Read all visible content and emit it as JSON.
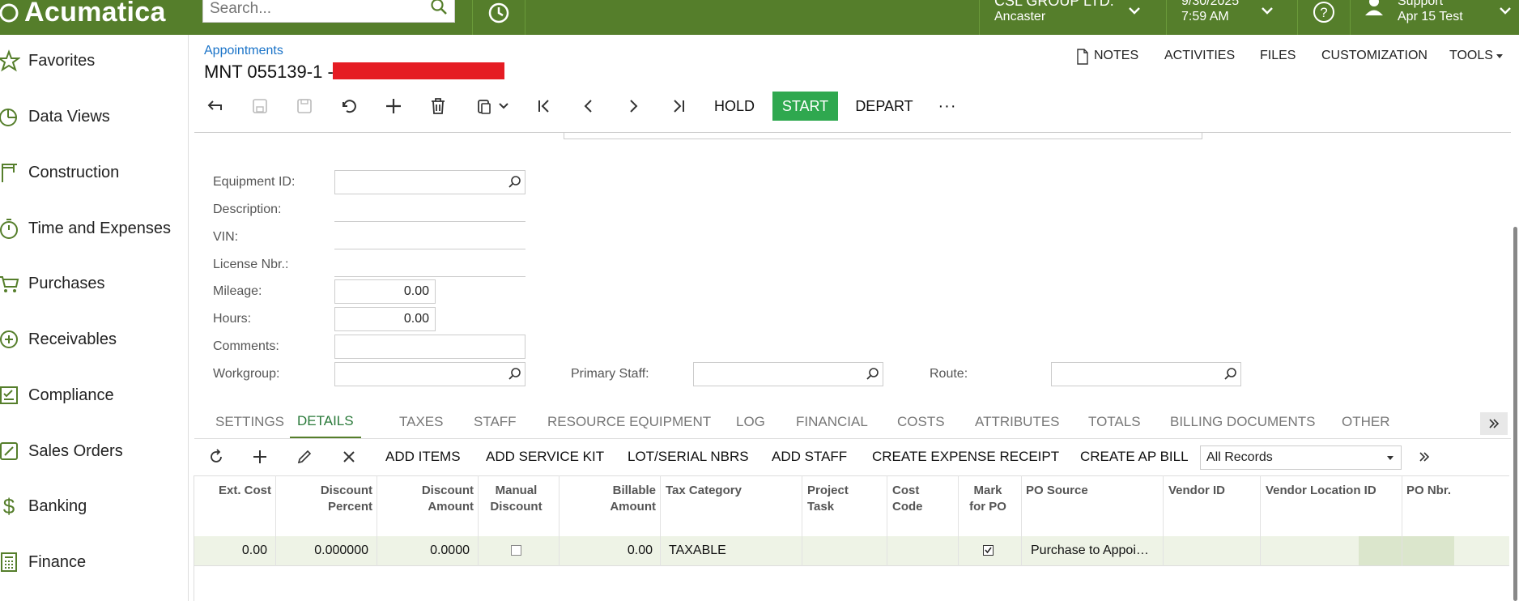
{
  "header": {
    "brand": "Acumatica",
    "search_placeholder": "Search...",
    "tenant_name": "CSL GROUP LTD.",
    "tenant_branch": "Ancaster",
    "date": "9/30/2025",
    "time": "7:59 AM",
    "user_name": "Support",
    "user_sub": "Apr 15 Test",
    "brand_color": "#557e2b"
  },
  "sidebar": {
    "items": [
      {
        "label": "Favorites",
        "icon": "star-icon"
      },
      {
        "label": "Data Views",
        "icon": "pie-chart-icon"
      },
      {
        "label": "Construction",
        "icon": "crane-icon"
      },
      {
        "label": "Time and Expenses",
        "icon": "stopwatch-icon"
      },
      {
        "label": "Purchases",
        "icon": "cart-icon"
      },
      {
        "label": "Receivables",
        "icon": "plus-circle-icon"
      },
      {
        "label": "Compliance",
        "icon": "checklist-icon"
      },
      {
        "label": "Sales Orders",
        "icon": "pencil-icon"
      },
      {
        "label": "Banking",
        "icon": "dollar-icon"
      },
      {
        "label": "Finance",
        "icon": "calculator-icon"
      }
    ]
  },
  "page": {
    "breadcrumb": "Appointments",
    "title": "MNT 055139-1 -",
    "top_links": [
      "NOTES",
      "ACTIVITIES",
      "FILES",
      "CUSTOMIZATION",
      "TOOLS"
    ],
    "actions": {
      "hold": "HOLD",
      "start": "START",
      "depart": "DEPART",
      "more": "···"
    }
  },
  "form": {
    "equipment_id_label": "Equipment ID:",
    "equipment_id_value": "",
    "description_label": "Description:",
    "vin_label": "VIN:",
    "license_label": "License Nbr.:",
    "mileage_label": "Mileage:",
    "mileage_value": "0.00",
    "hours_label": "Hours:",
    "hours_value": "0.00",
    "comments_label": "Comments:",
    "workgroup_label": "Workgroup:",
    "primary_staff_label": "Primary Staff:",
    "route_label": "Route:"
  },
  "tabs": [
    "SETTINGS",
    "DETAILS",
    "TAXES",
    "STAFF",
    "RESOURCE EQUIPMENT",
    "LOG",
    "FINANCIAL",
    "COSTS",
    "ATTRIBUTES",
    "TOTALS",
    "BILLING DOCUMENTS",
    "OTHER"
  ],
  "grid_toolbar": {
    "add_items": "ADD ITEMS",
    "add_service_kit": "ADD SERVICE KIT",
    "lot_serial": "LOT/SERIAL NBRS",
    "add_staff": "ADD STAFF",
    "create_expense": "CREATE EXPENSE RECEIPT",
    "create_ap_bill": "CREATE AP BILL",
    "filter": "All Records"
  },
  "grid": {
    "columns": [
      {
        "l1": "Ext. Cost",
        "l2": ""
      },
      {
        "l1": "Discount",
        "l2": "Percent"
      },
      {
        "l1": "Discount",
        "l2": "Amount"
      },
      {
        "l1": "Manual",
        "l2": "Discount"
      },
      {
        "l1": "Billable",
        "l2": "Amount"
      },
      {
        "l1": "Tax Category",
        "l2": ""
      },
      {
        "l1": "Project",
        "l2": "Task"
      },
      {
        "l1": "Cost",
        "l2": "Code"
      },
      {
        "l1": "Mark",
        "l2": "for PO"
      },
      {
        "l1": "PO Source",
        "l2": ""
      },
      {
        "l1": "Vendor ID",
        "l2": ""
      },
      {
        "l1": "Vendor Location ID",
        "l2": ""
      },
      {
        "l1": "PO Nbr.",
        "l2": ""
      }
    ],
    "row": {
      "ext_cost": "0.00",
      "discount_percent": "0.000000",
      "discount_amount": "0.0000",
      "manual_discount": false,
      "billable_amount": "0.00",
      "tax_category": "TAXABLE",
      "project_task": "",
      "cost_code": "",
      "mark_for_po": true,
      "po_source": "Purchase to Appoi…",
      "vendor_id": "",
      "vendor_location_id": "",
      "po_nbr": ""
    }
  }
}
